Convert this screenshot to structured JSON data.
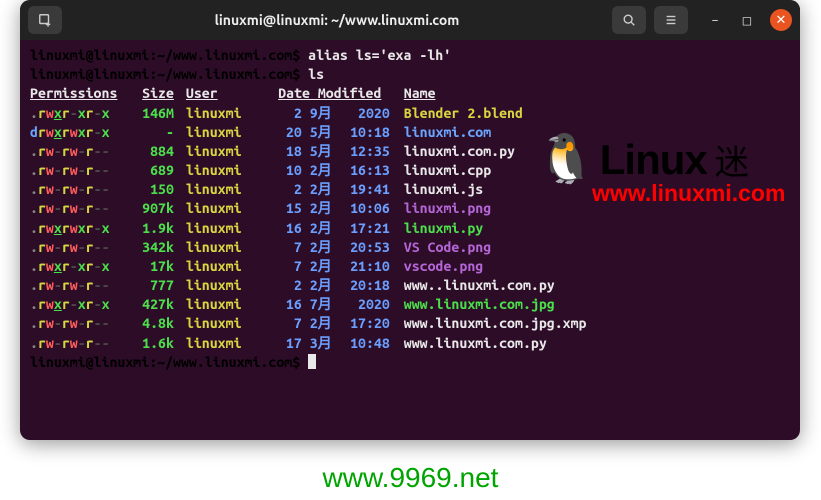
{
  "window": {
    "title": "linuxmi@linuxmi: ~/www.linuxmi.com"
  },
  "colors": {
    "perm_colors": {
      "dash": "#4a4a4a",
      "dot": "#888888",
      "d": "#6aa6ff",
      "r": "#d6d640",
      "w": "#ff5c5c",
      "x": "#4be04b",
      "x_underline": "#4be04b"
    },
    "size": "#4be04b",
    "user": "#d6d640",
    "date": "#6a9fff",
    "name_default": "#e8e8e8",
    "name_exe": "#4be04b",
    "name_dir": "#6aa6ff",
    "name_img": "#b466d6",
    "name_special": "#d6d640"
  },
  "prompt": {
    "user_host": "linuxmi@linuxmi",
    "colon": ":",
    "path": "~/www.linuxmi.com",
    "dollar": "$"
  },
  "commands": [
    "alias ls='exa -lh'",
    "ls"
  ],
  "headers": {
    "permissions": "Permissions",
    "size": "Size",
    "user": "User",
    "date": "Date Modified",
    "name": "Name"
  },
  "rows": [
    {
      "perm": ".rwxr-xr-x",
      "size": "146M",
      "user": "linuxmi",
      "date": "2 9月",
      "time": "2020",
      "name": "Blender 2.blend",
      "kind": "special"
    },
    {
      "perm": "drwxrwxr-x",
      "size": "-",
      "user": "linuxmi",
      "date": "20 5月",
      "time": "10:18",
      "name": "linuxmi.com",
      "kind": "dir"
    },
    {
      "perm": ".rw-rw-r--",
      "size": "884",
      "user": "linuxmi",
      "date": "18 5月",
      "time": "12:35",
      "name": "linuxmi.com.py",
      "kind": "default"
    },
    {
      "perm": ".rw-rw-r--",
      "size": "689",
      "user": "linuxmi",
      "date": "10 2月",
      "time": "16:13",
      "name": "linuxmi.cpp",
      "kind": "default"
    },
    {
      "perm": ".rw-rw-r--",
      "size": "150",
      "user": "linuxmi",
      "date": "2 2月",
      "time": "19:41",
      "name": "linuxmi.js",
      "kind": "default"
    },
    {
      "perm": ".rw-rw-r--",
      "size": "907k",
      "user": "linuxmi",
      "date": "15 2月",
      "time": "10:06",
      "name": "linuxmi.png",
      "kind": "img"
    },
    {
      "perm": ".rwxrwxr-x",
      "size": "1.9k",
      "user": "linuxmi",
      "date": "16 2月",
      "time": "17:21",
      "name": "linuxmi.py",
      "kind": "exe"
    },
    {
      "perm": ".rw-rw-r--",
      "size": "342k",
      "user": "linuxmi",
      "date": "7 2月",
      "time": "20:53",
      "name": "VS Code.png",
      "kind": "img"
    },
    {
      "perm": ".rwxr-xr-x",
      "size": "17k",
      "user": "linuxmi",
      "date": "7 2月",
      "time": "21:10",
      "name": "vscode.png",
      "kind": "img"
    },
    {
      "perm": ".rw-rw-r--",
      "size": "777",
      "user": "linuxmi",
      "date": "2 2月",
      "time": "20:18",
      "name": "www..linuxmi.com.py",
      "kind": "default"
    },
    {
      "perm": ".rwxr-xr-x",
      "size": "427k",
      "user": "linuxmi",
      "date": "16 7月",
      "time": "2020",
      "name": "www.linuxmi.com.jpg",
      "kind": "exe"
    },
    {
      "perm": ".rw-rw-r--",
      "size": "4.8k",
      "user": "linuxmi",
      "date": "7 2月",
      "time": "17:20",
      "name": "www.linuxmi.com.jpg.xmp",
      "kind": "default"
    },
    {
      "perm": ".rw-rw-r--",
      "size": "1.6k",
      "user": "linuxmi",
      "date": "17 3月",
      "time": "10:48",
      "name": "www.linuxmi.com.py",
      "kind": "default"
    }
  ],
  "watermark": {
    "text": "Linux",
    "cn": "迷",
    "url": "www.linuxmi.com"
  },
  "footer": "www.9969.net"
}
